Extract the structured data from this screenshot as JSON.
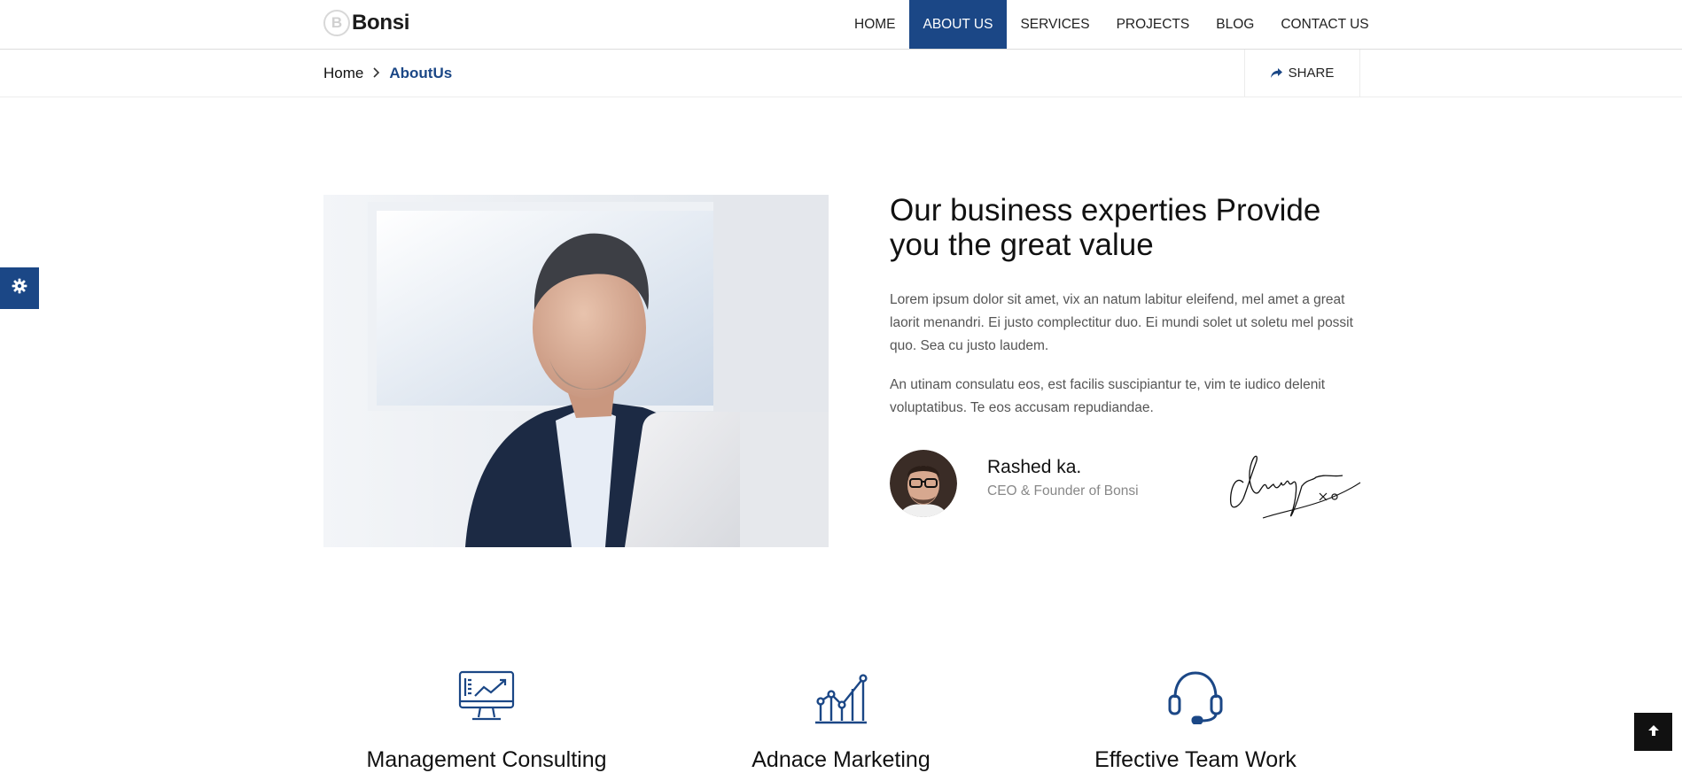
{
  "brand": {
    "logo_letter": "B",
    "name": "Bonsi",
    "accent_color": "#1b4786"
  },
  "nav": {
    "items": [
      {
        "label": "HOME",
        "active": false
      },
      {
        "label": "ABOUT US",
        "active": true
      },
      {
        "label": "SERVICES",
        "active": false
      },
      {
        "label": "PROJECTS",
        "active": false
      },
      {
        "label": "BLOG",
        "active": false
      },
      {
        "label": "CONTACT US",
        "active": false
      }
    ]
  },
  "breadcrumb": {
    "home": "Home",
    "current": "AboutUs"
  },
  "share": {
    "label": "SHARE",
    "icon": "share-icon"
  },
  "settings": {
    "icon": "gear-icon"
  },
  "about": {
    "heading": "Our business experties Provide you the great value",
    "paragraph1": "Lorem ipsum dolor sit amet, vix an natum labitur eleifend, mel amet a great laorit menandri. Ei justo complectitur duo. Ei mundi solet ut soletu mel possit quo. Sea cu justo laudem.",
    "paragraph2": "An utinam consulatu eos, est facilis suscipiantur te, vim te iudico delenit voluptatibus. Te eos accusam repudiandae.",
    "person": {
      "name": "Rashed ka.",
      "role": "CEO & Founder of Bonsi"
    }
  },
  "services": [
    {
      "title": "Management Consulting",
      "icon": "monitor-chart-icon"
    },
    {
      "title": "Adnace Marketing",
      "icon": "growth-chart-icon"
    },
    {
      "title": "Effective Team Work",
      "icon": "headset-icon"
    }
  ],
  "back_to_top": {
    "icon": "arrow-up-icon"
  }
}
